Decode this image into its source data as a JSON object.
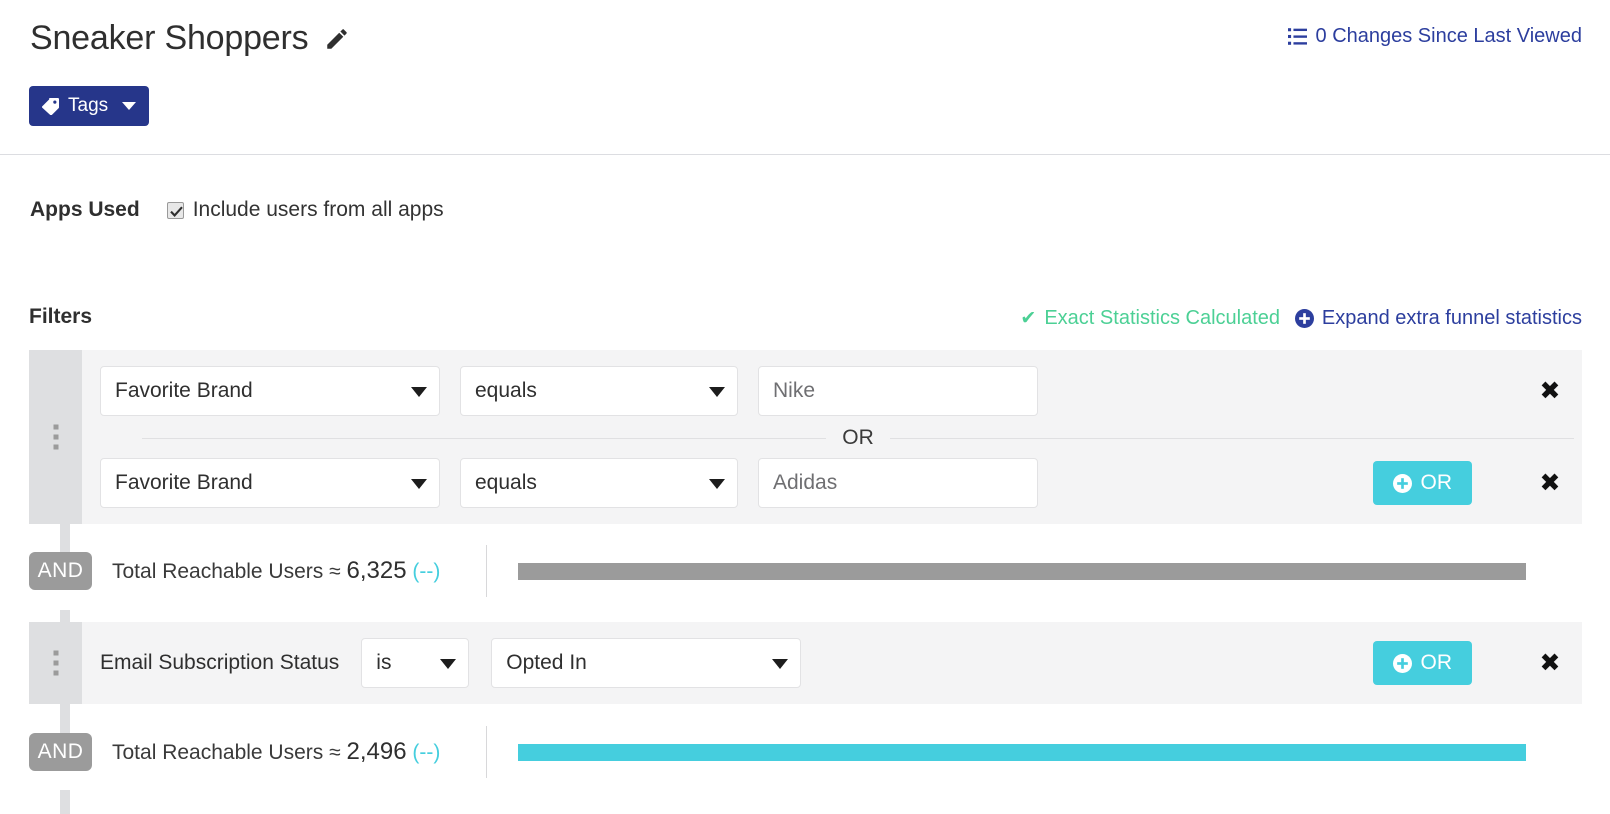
{
  "header": {
    "segment_title": "Sneaker Shoppers",
    "edit_icon": "pencil-icon",
    "tags_button_label": "Tags",
    "tags_icon": "tag-icon",
    "changes_link_label": "0 Changes Since Last Viewed",
    "changes_icon": "list-icon"
  },
  "apps_used": {
    "label": "Apps Used",
    "checkbox_label": "Include users from all apps",
    "checkbox_checked": true
  },
  "filters": {
    "label": "Filters",
    "exact_stats_label": "Exact Statistics Calculated",
    "exact_stats_icon": "check-icon",
    "exact_stats_color": "#4cd095",
    "expand_stats_label": "Expand extra funnel statistics",
    "expand_stats_icon": "plus-circle-icon",
    "expand_stats_color": "#2c3e9e"
  },
  "builder": {
    "or_label": "OR",
    "and_label": "AND",
    "or_button_label": "OR",
    "remove_label": "✖",
    "group1": {
      "rows": [
        {
          "attribute": "Favorite Brand",
          "operator": "equals",
          "value": "Nike",
          "has_or_button": false
        },
        {
          "attribute": "Favorite Brand",
          "operator": "equals",
          "value": "Adidas",
          "has_or_button": true
        }
      ]
    },
    "group2": {
      "rows": [
        {
          "attribute": "Email Subscription Status",
          "operator": "is",
          "value": "Opted In",
          "has_or_button": true
        }
      ]
    },
    "stats": [
      {
        "label": "Total Reachable Users ≈",
        "value": "6,325",
        "delta": "(--)",
        "bar_color": "#9b9b9b",
        "bar_percent": 100
      },
      {
        "label": "Total Reachable Users ≈",
        "value": "2,496",
        "delta": "(--)",
        "bar_color": "#45cede",
        "bar_percent": 100
      }
    ]
  }
}
